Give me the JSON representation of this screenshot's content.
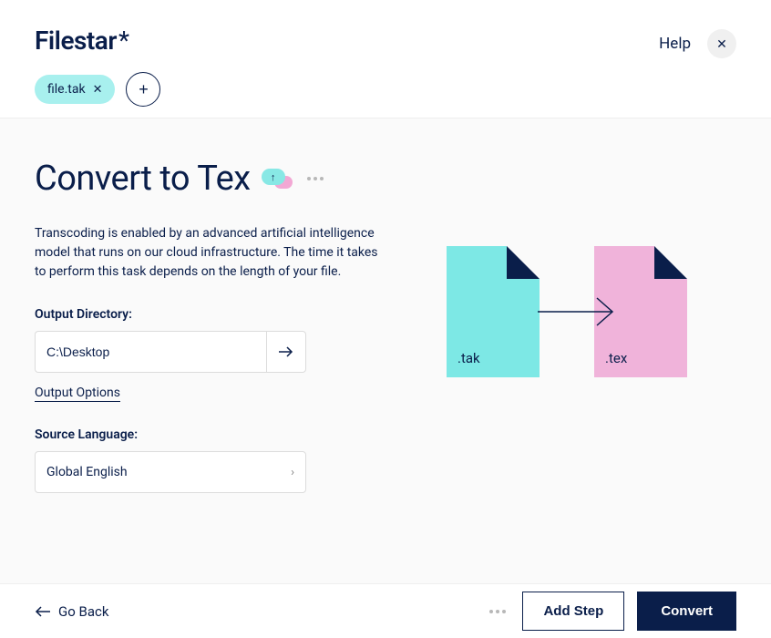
{
  "brand": "Filestar",
  "header": {
    "help_label": "Help"
  },
  "file_chip": {
    "name": "file.tak"
  },
  "page": {
    "title": "Convert to Tex",
    "description": "Transcoding is enabled by an advanced artificial intelligence model that runs on our cloud infrastructure. The time it takes to perform this task depends on the length of your file."
  },
  "form": {
    "output_dir_label": "Output Directory:",
    "output_dir_value": "C:\\Desktop",
    "output_options_label": "Output Options",
    "source_lang_label": "Source Language:",
    "source_lang_value": "Global English"
  },
  "diagram": {
    "from_ext": ".tak",
    "to_ext": ".tex"
  },
  "footer": {
    "go_back_label": "Go Back",
    "add_step_label": "Add Step",
    "convert_label": "Convert"
  }
}
